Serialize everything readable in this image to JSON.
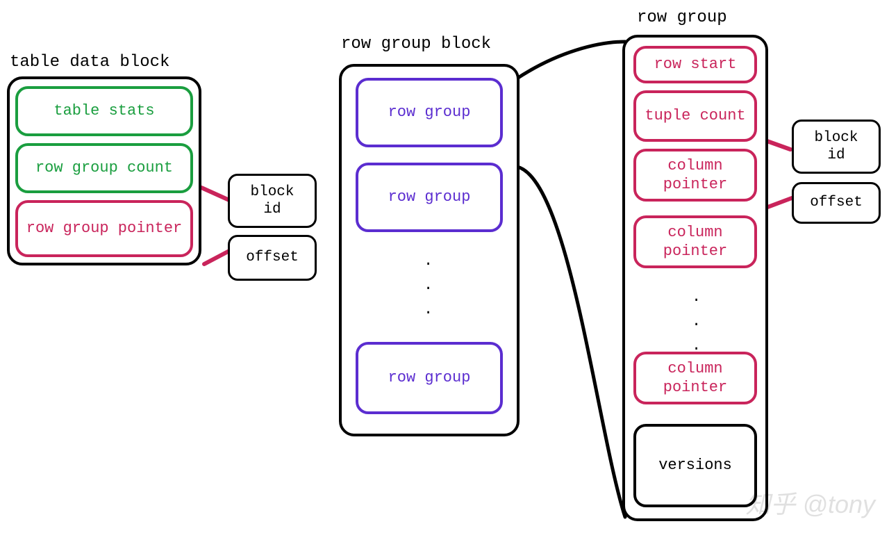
{
  "table_data_block": {
    "title": "table data block",
    "cells": {
      "table_stats": "table stats",
      "row_group_count": "row group count",
      "row_group_pointer": "row group pointer"
    },
    "pointer_parts": {
      "block_id": "block id",
      "offset": "offset"
    }
  },
  "row_group_block": {
    "title": "row group block",
    "cells": {
      "row_group_1": "row group",
      "row_group_2": "row group",
      "row_group_n": "row group"
    }
  },
  "row_group": {
    "title": "row group",
    "cells": {
      "row_start": "row start",
      "tuple_count": "tuple count",
      "column_pointer_1": "column pointer",
      "column_pointer_2": "column pointer",
      "column_pointer_n": "column pointer",
      "versions": "versions"
    },
    "pointer_parts": {
      "block_id": "block id",
      "offset": "offset"
    }
  },
  "watermark": "知乎 @tony",
  "colors": {
    "green": "#1a9e3f",
    "pink": "#c9245b",
    "purple": "#5b2dd0",
    "black": "#000000"
  }
}
